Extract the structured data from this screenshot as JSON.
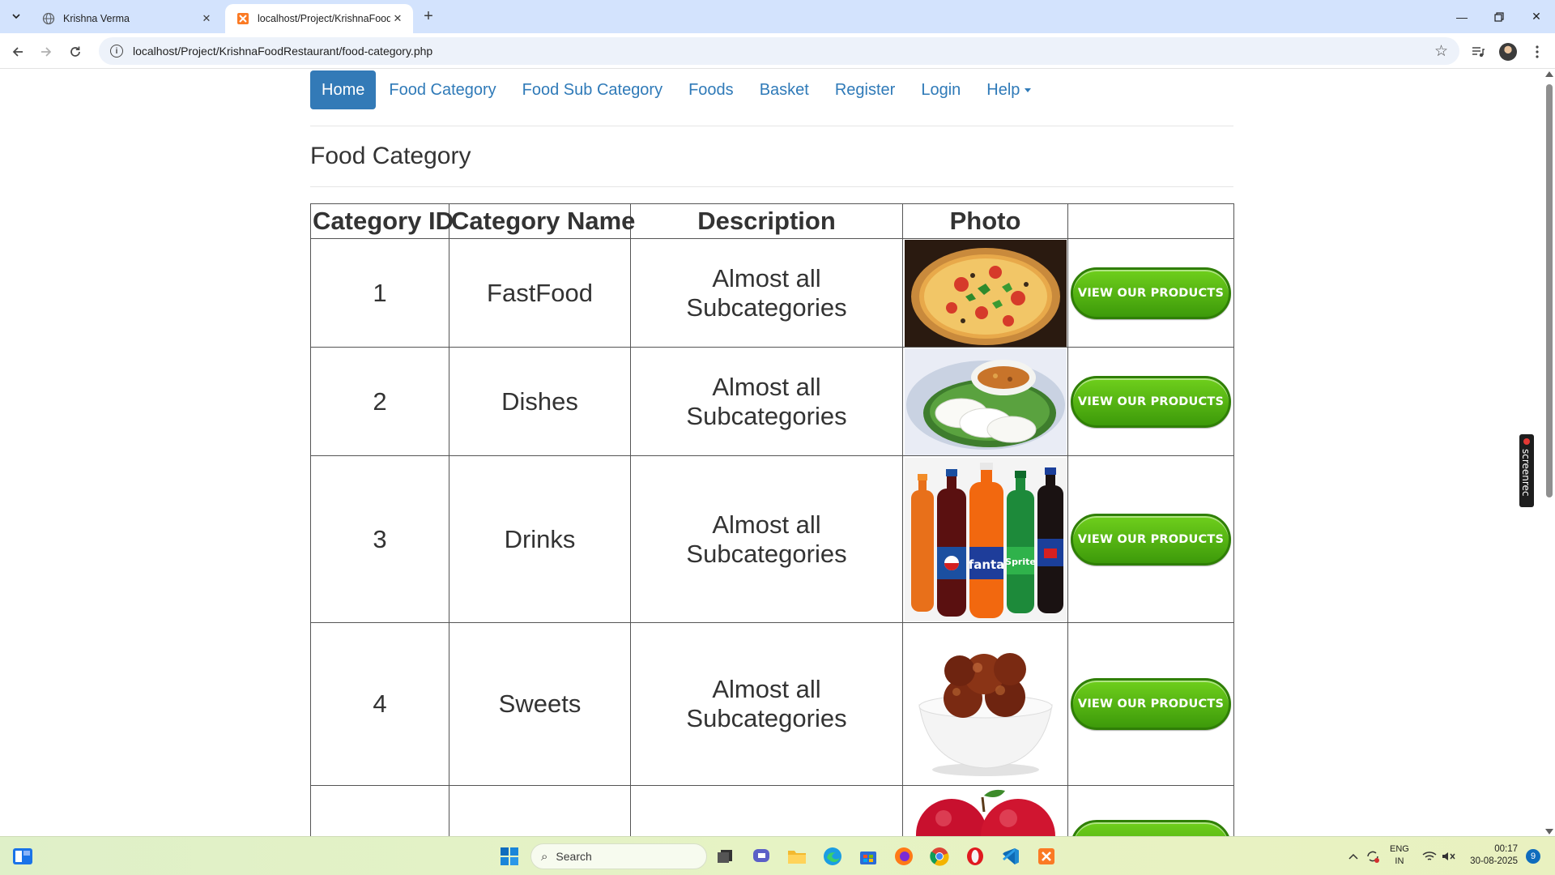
{
  "browser": {
    "tabs": [
      {
        "title": "Krishna Verma",
        "active": false
      },
      {
        "title": "localhost/Project/KrishnaFoodR",
        "active": true
      }
    ],
    "url": "localhost/Project/KrishnaFoodRestaurant/food-category.php"
  },
  "nav": {
    "home": "Home",
    "food_category": "Food Category",
    "food_sub_category": "Food Sub Category",
    "foods": "Foods",
    "basket": "Basket",
    "register": "Register",
    "login": "Login",
    "help": "Help"
  },
  "page": {
    "title": "Food Category"
  },
  "table": {
    "headers": [
      "Category ID",
      "Category Name",
      "Description",
      "Photo",
      ""
    ],
    "button_label": "VIEW OUR PRODUCTS",
    "rows": [
      {
        "id": "1",
        "name": "FastFood",
        "description": "Almost all Subcategories",
        "photo": "pizza"
      },
      {
        "id": "2",
        "name": "Dishes",
        "description": "Almost all Subcategories",
        "photo": "idli-sambar"
      },
      {
        "id": "3",
        "name": "Drinks",
        "description": "Almost all Subcategories",
        "photo": "soft-drink-bottles"
      },
      {
        "id": "4",
        "name": "Sweets",
        "description": "Almost all Subcategories",
        "photo": "gulab-jamun"
      },
      {
        "id": "",
        "name": "",
        "description": "",
        "photo": "apples"
      }
    ]
  },
  "screenrec": {
    "label": "screenrec"
  },
  "taskbar": {
    "search_placeholder": "Search",
    "lang_top": "ENG",
    "lang_bottom": "IN",
    "time": "00:17",
    "date": "30-08-2025",
    "notification_count": "9"
  },
  "colors": {
    "nav_link": "#2f7ab8",
    "nav_active_bg": "#337ab7",
    "button_green": "#4fb010"
  }
}
